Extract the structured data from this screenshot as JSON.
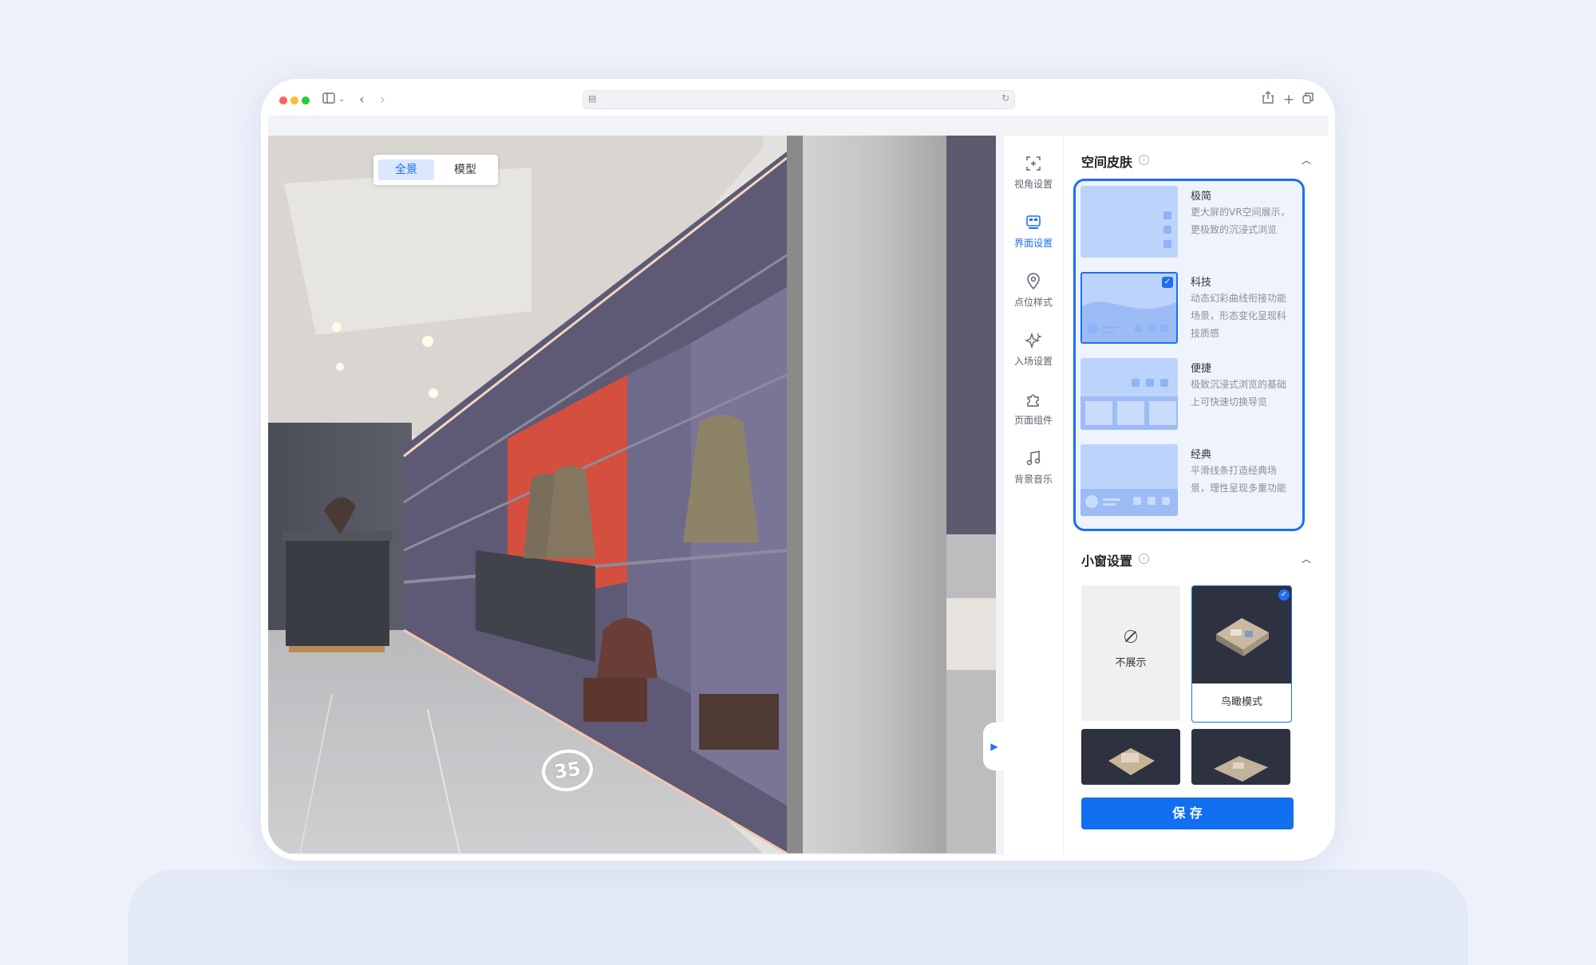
{
  "viewer": {
    "mode_tabs": [
      {
        "label": "全景",
        "active": true
      },
      {
        "label": "模型",
        "active": false
      }
    ],
    "hotspot_marker": "35"
  },
  "nav": {
    "items": [
      {
        "label": "视角设置",
        "icon": "viewpoint-icon",
        "active": false
      },
      {
        "label": "界面设置",
        "icon": "layout-icon",
        "active": true
      },
      {
        "label": "点位样式",
        "icon": "location-pin-icon",
        "active": false
      },
      {
        "label": "入场设置",
        "icon": "sparkle-icon",
        "active": false
      },
      {
        "label": "页面组件",
        "icon": "puzzle-icon",
        "active": false
      },
      {
        "label": "背景音乐",
        "icon": "music-icon",
        "active": false
      }
    ]
  },
  "panel": {
    "skin": {
      "title": "空间皮肤",
      "options": [
        {
          "name": "极简",
          "desc": "更大屏的VR空间展示，更极致的沉浸式浏览",
          "selected": false
        },
        {
          "name": "科技",
          "desc": "动态幻彩曲线衔接功能场景，形态变化呈现科技质感",
          "selected": true
        },
        {
          "name": "便捷",
          "desc": "极致沉浸式浏览的基础上可快速切换导览",
          "selected": false
        },
        {
          "name": "经典",
          "desc": "平滑线条打造经典场景，理性呈现多重功能",
          "selected": false
        }
      ]
    },
    "miniwindow": {
      "title": "小窗设置",
      "options": [
        {
          "label": "不展示",
          "selected": false
        },
        {
          "label": "鸟瞰模式",
          "selected": true
        }
      ]
    },
    "save_label": "保 存"
  },
  "colors": {
    "accent": "#1d6ff2",
    "skin_card_bg": "#bcd4fb",
    "page_bg": "#edf1fa"
  }
}
